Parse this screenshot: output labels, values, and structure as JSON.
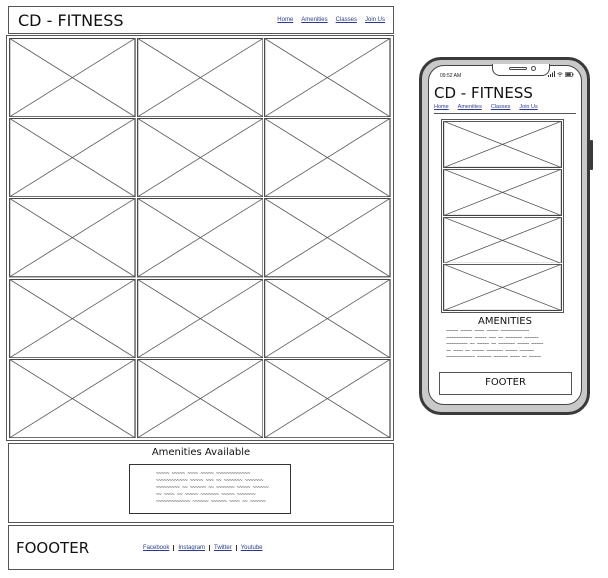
{
  "desktop": {
    "header": {
      "brand": "CD - FITNESS",
      "nav": [
        "Home",
        "Amenities",
        "Classes",
        "Join Us"
      ]
    },
    "gallery": {
      "rows": 5,
      "columns": 3
    },
    "amenities": {
      "heading": "Amenities Available"
    },
    "footer": {
      "label": "FOOOTER",
      "links": [
        "Facebook",
        "Instagram",
        "Twitter",
        "Youtube"
      ]
    }
  },
  "mobile": {
    "status": {
      "time": "09:52 AM"
    },
    "header": {
      "brand": "CD - FITNESS",
      "nav": [
        "Home",
        "Amenities",
        "Classes",
        "Join Us"
      ]
    },
    "gallery": {
      "rows": 4,
      "columns": 1
    },
    "amenities": {
      "heading": "AMENITIES"
    },
    "footer": {
      "label": "FOOTER"
    }
  },
  "icons": [
    "image-placeholder-icon",
    "signal-icon",
    "wifi-icon",
    "battery-icon"
  ]
}
